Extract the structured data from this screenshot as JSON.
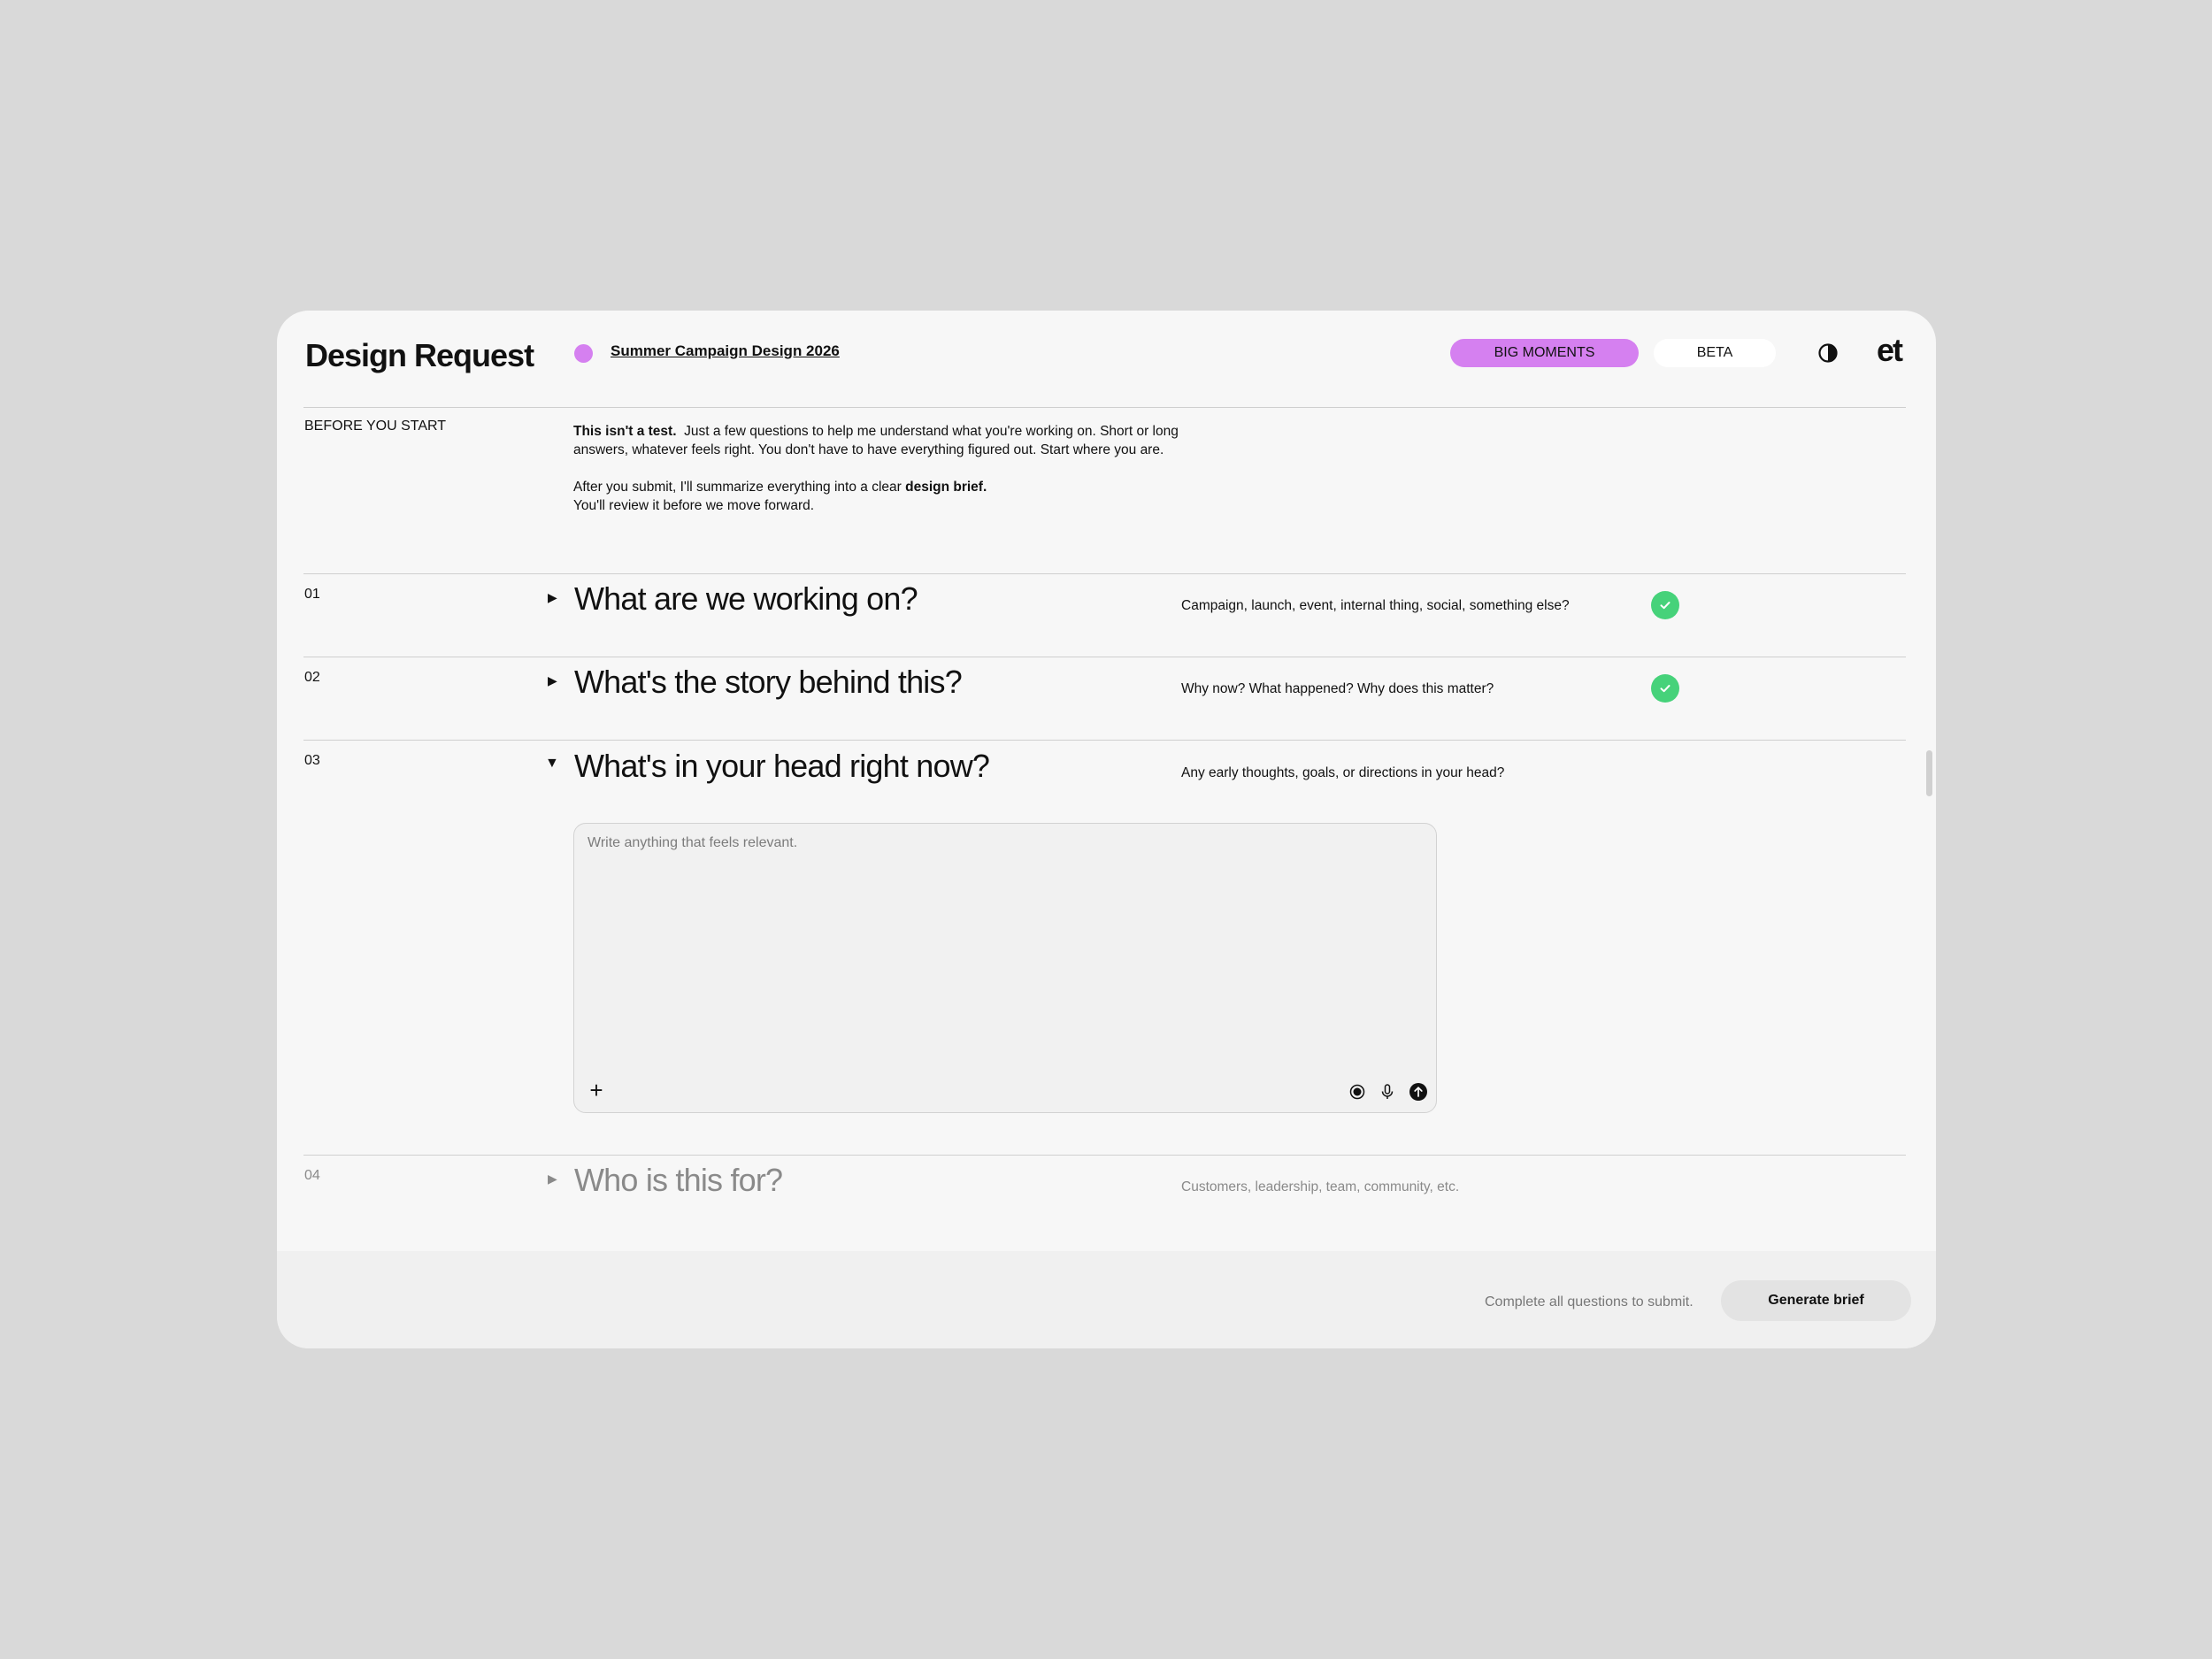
{
  "header": {
    "title": "Design Request",
    "project_name": "Summer Campaign Design 2026",
    "project_dot_color": "#d580f0",
    "tag_primary": "BIG MOMENTS",
    "tag_secondary": "BETA",
    "theme_toggle_icon": "contrast-icon",
    "logo": "et"
  },
  "intro": {
    "label": "BEFORE YOU START",
    "p1_bold": "This isn't a test.",
    "p1_rest": "Just a few questions to help me understand what you're working on. Short or long answers, whatever feels right. You don't have to have everything figured out. Start where you are.",
    "p2_pre": "After you submit, I'll summarize everything into a clear",
    "p2_bold": "design brief.",
    "p2_line2": "You'll review it before we move forward."
  },
  "questions": [
    {
      "num": "01",
      "title": "What are we working on?",
      "hint": "Campaign, launch, event, internal thing, social, something else?",
      "status": "complete",
      "expanded": false
    },
    {
      "num": "02",
      "title": "What's the story behind this?",
      "hint": "Why now? What happened? Why does this matter?",
      "status": "complete",
      "expanded": false
    },
    {
      "num": "03",
      "title": "What's in your head right now?",
      "hint": "Any early thoughts, goals, or directions in your head?",
      "status": "active",
      "expanded": true
    },
    {
      "num": "04",
      "title": "Who is this for?",
      "hint": "Customers, leadership, team, community, etc.",
      "status": "pending",
      "expanded": false
    }
  ],
  "composer": {
    "placeholder": "Write anything that feels relevant.",
    "value": "",
    "tools": [
      "plus-icon",
      "record-icon",
      "microphone-icon",
      "send-arrow-icon"
    ]
  },
  "footer": {
    "note": "Complete all questions to submit.",
    "button_label": "Generate brief"
  },
  "colors": {
    "accent": "#d580f0",
    "success": "#46d27a",
    "background": "#d9d9d9",
    "card": "#f7f7f7"
  }
}
